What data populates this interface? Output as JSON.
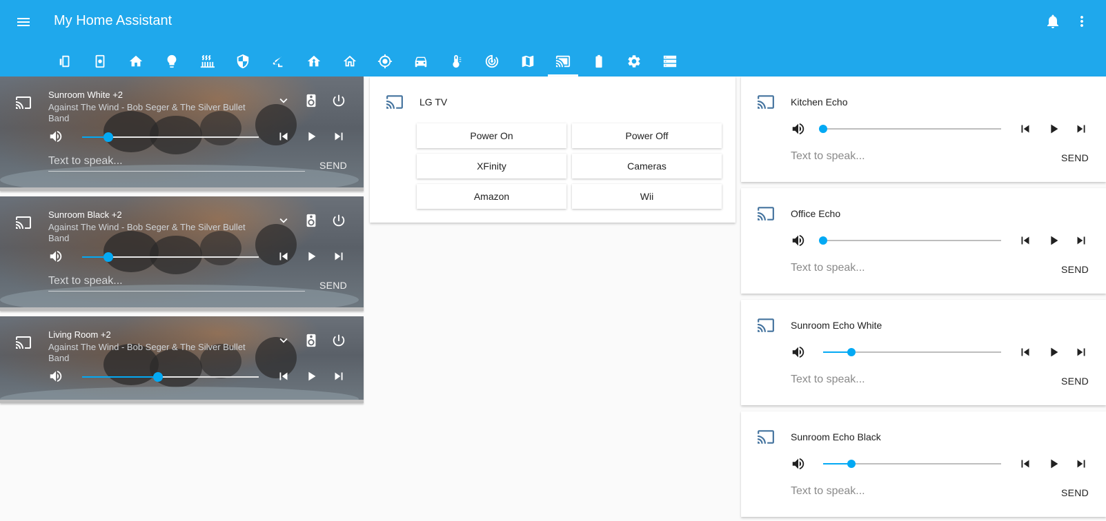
{
  "header": {
    "title": "My Home Assistant",
    "tabs": [
      {
        "icon": "tablet-cellphone-icon"
      },
      {
        "icon": "tablet-settings-icon"
      },
      {
        "icon": "home-icon"
      },
      {
        "icon": "lightbulb-icon"
      },
      {
        "icon": "radiator-icon"
      },
      {
        "icon": "shield-icon"
      },
      {
        "icon": "cctv-icon"
      },
      {
        "icon": "home-arrow-up-icon"
      },
      {
        "icon": "home-outline-icon"
      },
      {
        "icon": "crosshairs-gps-icon"
      },
      {
        "icon": "car-icon"
      },
      {
        "icon": "thermometer-icon"
      },
      {
        "icon": "radar-icon"
      },
      {
        "icon": "map-icon"
      },
      {
        "icon": "cast-connected-icon",
        "active": true
      },
      {
        "icon": "battery-icon"
      },
      {
        "icon": "settings-icon"
      },
      {
        "icon": "server-icon"
      }
    ]
  },
  "media_players": [
    {
      "name": "Sunroom White +2",
      "subtitle": "Against The Wind - Bob Seger & The Silver Bullet Band",
      "volume": 0.15,
      "tts_placeholder": "Text to speak...",
      "send_label": "SEND"
    },
    {
      "name": "Sunroom Black +2",
      "subtitle": "Against The Wind - Bob Seger & The Silver Bullet Band",
      "volume": 0.15,
      "tts_placeholder": "Text to speak...",
      "send_label": "SEND"
    },
    {
      "name": "Living Room +2",
      "subtitle": "Against The Wind - Bob Seger & The Silver Bullet Band",
      "volume": 0.43
    }
  ],
  "tv": {
    "name": "LG TV",
    "buttons": [
      "Power On",
      "Power Off",
      "XFinity",
      "Cameras",
      "Amazon",
      "Wii"
    ]
  },
  "echos": [
    {
      "name": "Kitchen Echo",
      "volume": 0.0,
      "tts_placeholder": "Text to speak...",
      "send_label": "SEND"
    },
    {
      "name": "Office Echo",
      "volume": 0.0,
      "tts_placeholder": "Text to speak...",
      "send_label": "SEND"
    },
    {
      "name": "Sunroom Echo White",
      "volume": 0.16,
      "tts_placeholder": "Text to speak...",
      "send_label": "SEND"
    },
    {
      "name": "Sunroom Echo Black",
      "volume": 0.16,
      "tts_placeholder": "Text to speak...",
      "send_label": "SEND"
    }
  ],
  "colors": {
    "header": "#1fa8ec",
    "accent": "#03a9f4",
    "cast_icon": "#44739e"
  }
}
